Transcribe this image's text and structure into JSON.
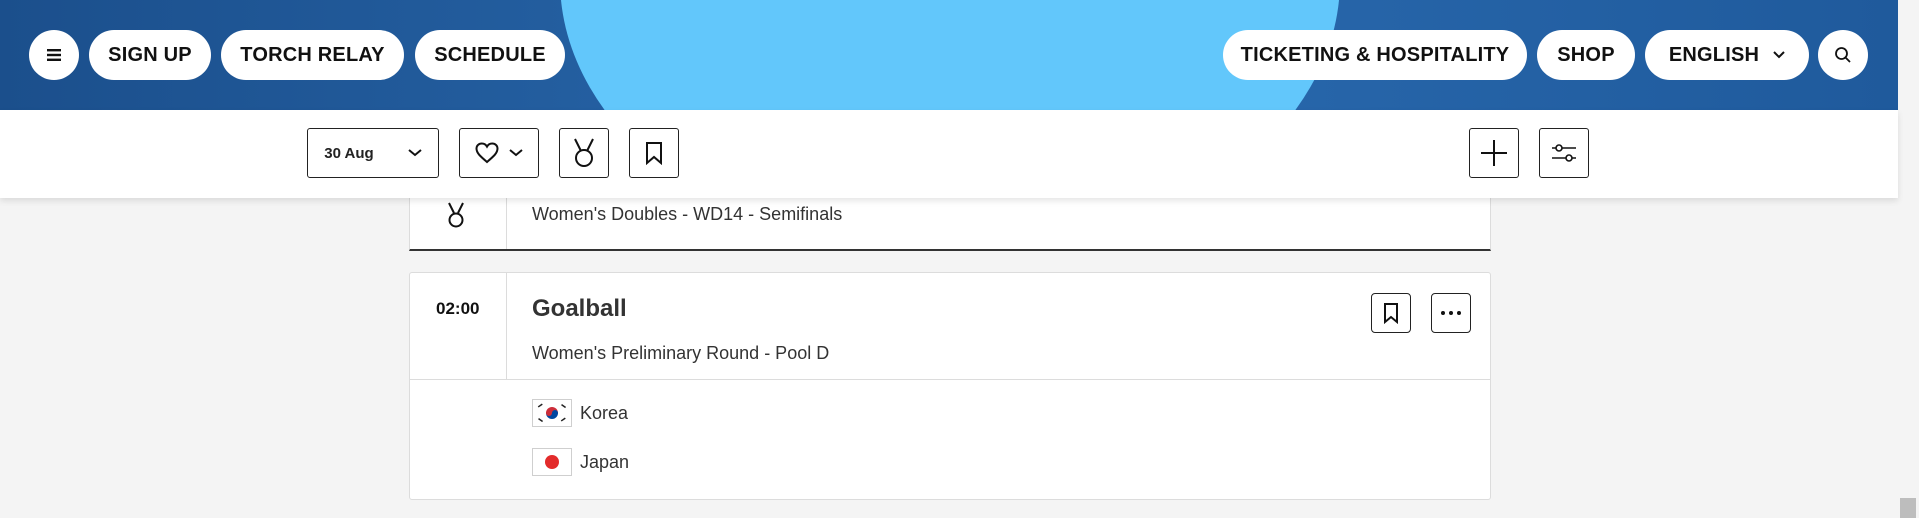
{
  "nav": {
    "menu_icon": "hamburger-icon",
    "sign_up": "SIGN UP",
    "torch_relay": "TORCH RELAY",
    "schedule": "SCHEDULE",
    "ticketing": "TICKETING & HOSPITALITY",
    "shop": "SHOP",
    "language": "ENGLISH",
    "search_icon": "search-icon",
    "colors": {
      "bar": "#1f5a9c",
      "blob": "#62c7fb"
    }
  },
  "filters": {
    "date": "30 Aug",
    "favourite_icon": "heart-icon",
    "medal_icon": "medal-icon",
    "bookmark_icon": "bookmark-icon",
    "add_icon": "plus-icon",
    "settings_icon": "sliders-icon"
  },
  "events": [
    {
      "subtitle": "Women's Doubles - WD14 - Semifinals",
      "icon": "medal-icon"
    },
    {
      "time": "02:00",
      "sport": "Goalball",
      "subtitle": "Women's Preliminary Round - Pool D",
      "teams": [
        {
          "name": "Korea",
          "flag": "korea-flag-icon"
        },
        {
          "name": "Japan",
          "flag": "japan-flag-icon"
        }
      ]
    }
  ]
}
